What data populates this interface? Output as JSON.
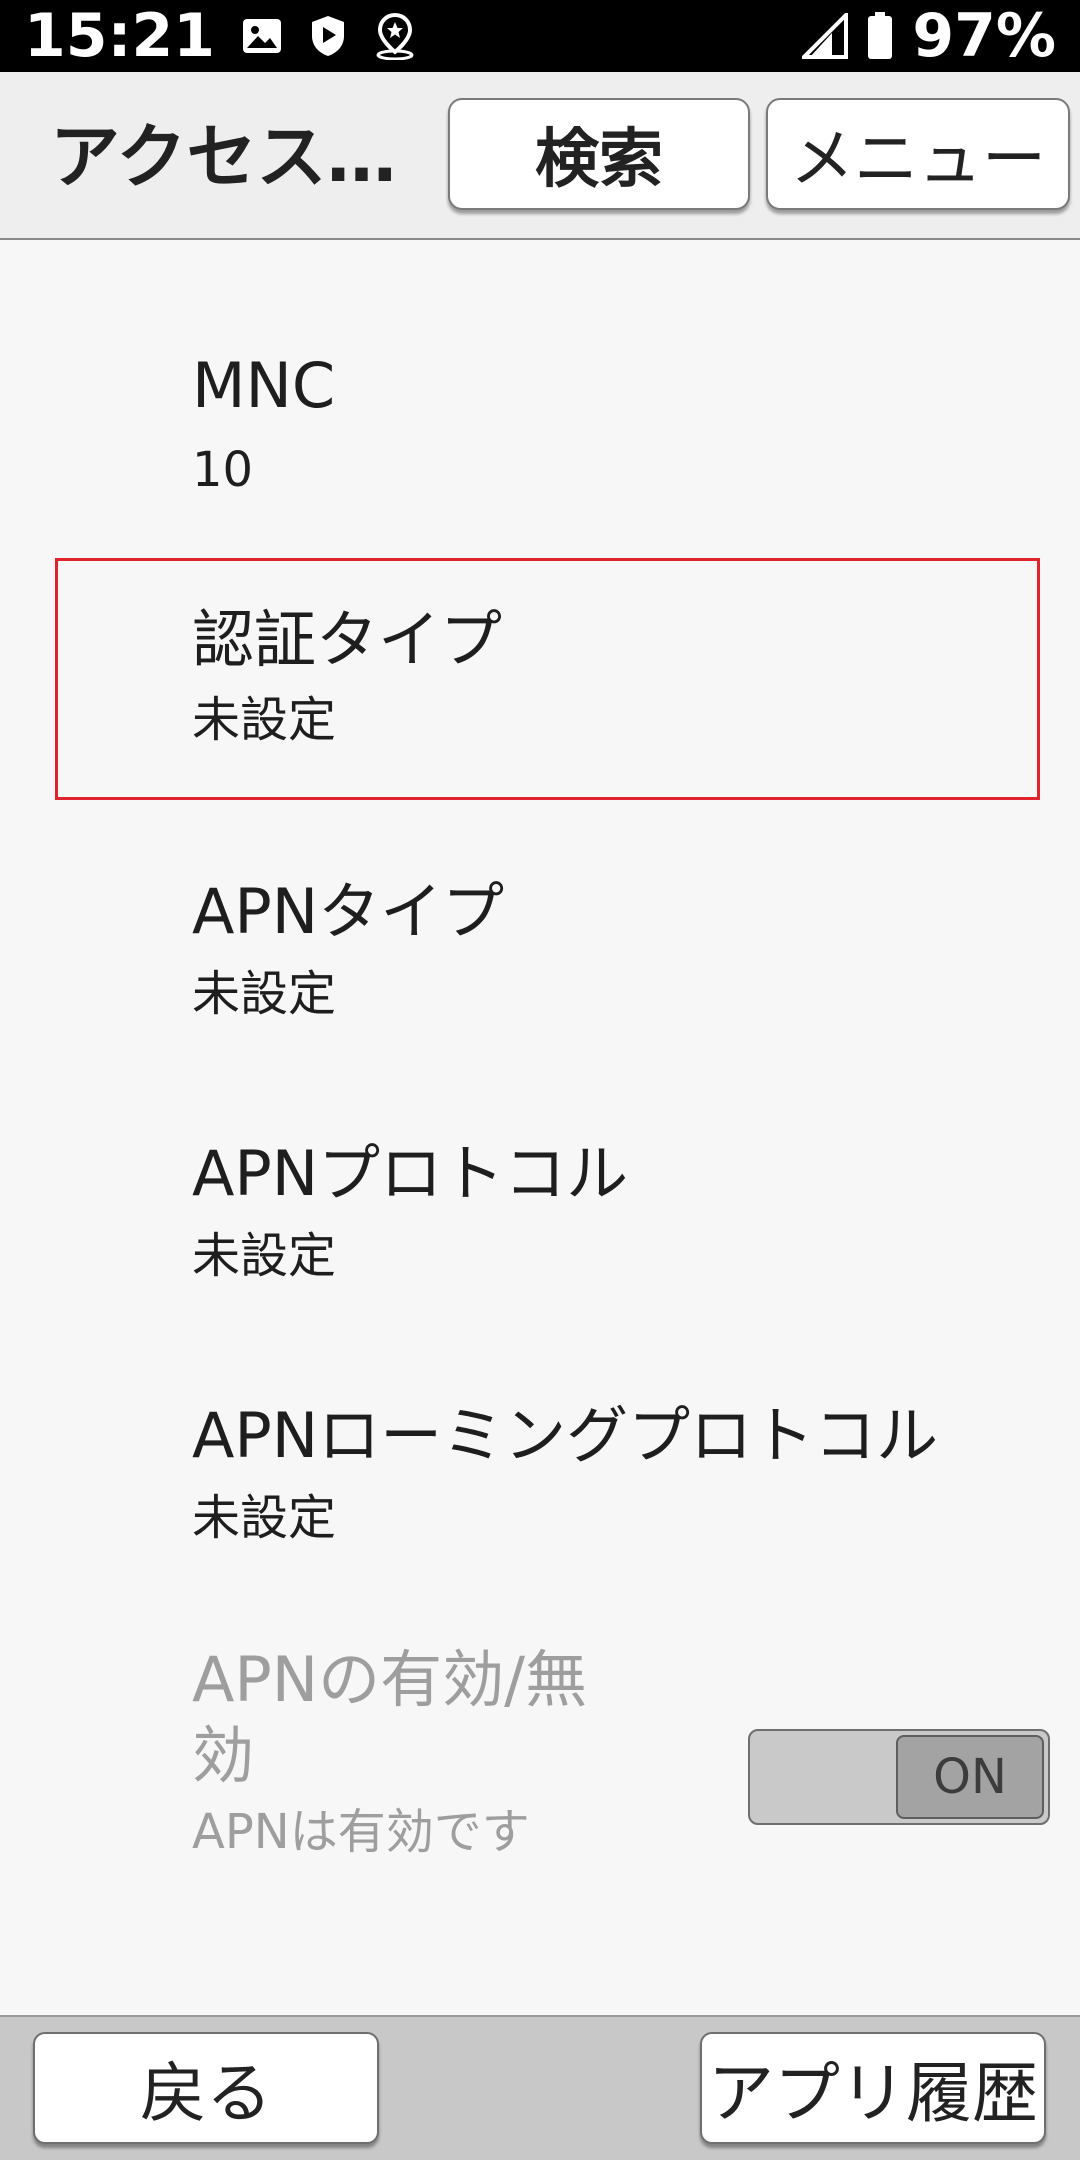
{
  "status_bar": {
    "time": "15:21",
    "icons": [
      "image-icon",
      "shield-play-icon",
      "location-pin-icon"
    ],
    "signal_icon": "signal-icon",
    "battery_icon": "battery-icon",
    "battery_percent": "97%"
  },
  "app_bar": {
    "title": "アクセス…",
    "search_label": "検索",
    "menu_label": "メニュー"
  },
  "settings": {
    "mnc": {
      "title": "MNC",
      "summary": "10"
    },
    "auth_type": {
      "title": "認証タイプ",
      "summary": "未設定"
    },
    "apn_type": {
      "title": "APNタイプ",
      "summary": "未設定"
    },
    "apn_protocol": {
      "title": "APNプロトコル",
      "summary": "未設定"
    },
    "apn_roaming_protocol": {
      "title": "APNローミングプロトコル",
      "summary": "未設定"
    },
    "apn_enable": {
      "title_line1": "APNの有効/無",
      "title_line2": "効",
      "summary": "APNは有効です",
      "toggle_label": "ON",
      "toggle_on": true
    }
  },
  "bottom_bar": {
    "back_label": "戻る",
    "history_label": "アプリ履歴"
  },
  "colors": {
    "status_bar_bg": "#000000",
    "highlight_border": "#e0242e",
    "disabled_text": "#9e9e9e"
  }
}
